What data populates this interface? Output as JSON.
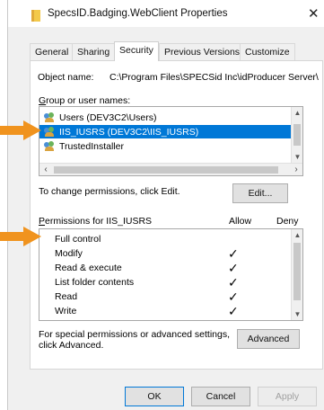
{
  "window": {
    "title": "SpecsID.Badging.WebClient Properties",
    "close_glyph": "✕"
  },
  "tabs": [
    {
      "label": "General",
      "active": false
    },
    {
      "label": "Sharing",
      "active": false
    },
    {
      "label": "Security",
      "active": true
    },
    {
      "label": "Previous Versions",
      "active": false
    },
    {
      "label": "Customize",
      "active": false
    }
  ],
  "security": {
    "object_name_label": "Object name:",
    "object_name_value": "C:\\Program Files\\SPECSid Inc\\idProducer Server\\",
    "group_label_prefix": "G",
    "group_label_rest": "roup or user names:",
    "users": [
      {
        "name": "Users (DEV3C2\\Users)",
        "selected": false,
        "icon": "users-icon"
      },
      {
        "name": "IIS_IUSRS (DEV3C2\\IIS_IUSRS)",
        "selected": true,
        "icon": "users-icon"
      },
      {
        "name": "TrustedInstaller",
        "selected": false,
        "icon": "users-icon"
      }
    ],
    "change_text": "To change permissions, click Edit.",
    "edit_button": "Edit...",
    "permissions_label_prefix": "P",
    "permissions_label_rest": "ermissions for IIS_IUSRS",
    "allow_header": "Allow",
    "deny_header": "Deny",
    "permissions": [
      {
        "name": "Full control",
        "allow": false,
        "deny": false
      },
      {
        "name": "Modify",
        "allow": true,
        "deny": false
      },
      {
        "name": "Read & execute",
        "allow": true,
        "deny": false
      },
      {
        "name": "List folder contents",
        "allow": true,
        "deny": false
      },
      {
        "name": "Read",
        "allow": true,
        "deny": false
      },
      {
        "name": "Write",
        "allow": true,
        "deny": false
      }
    ],
    "check_glyph": "✓",
    "special_text": "For special permissions or advanced settings, click Advanced.",
    "advanced_button": "Advanced"
  },
  "footer": {
    "ok": "OK",
    "cancel": "Cancel",
    "apply": "Apply"
  },
  "colors": {
    "selection": "#0078d7",
    "annotation_arrow": "#f0931e"
  }
}
